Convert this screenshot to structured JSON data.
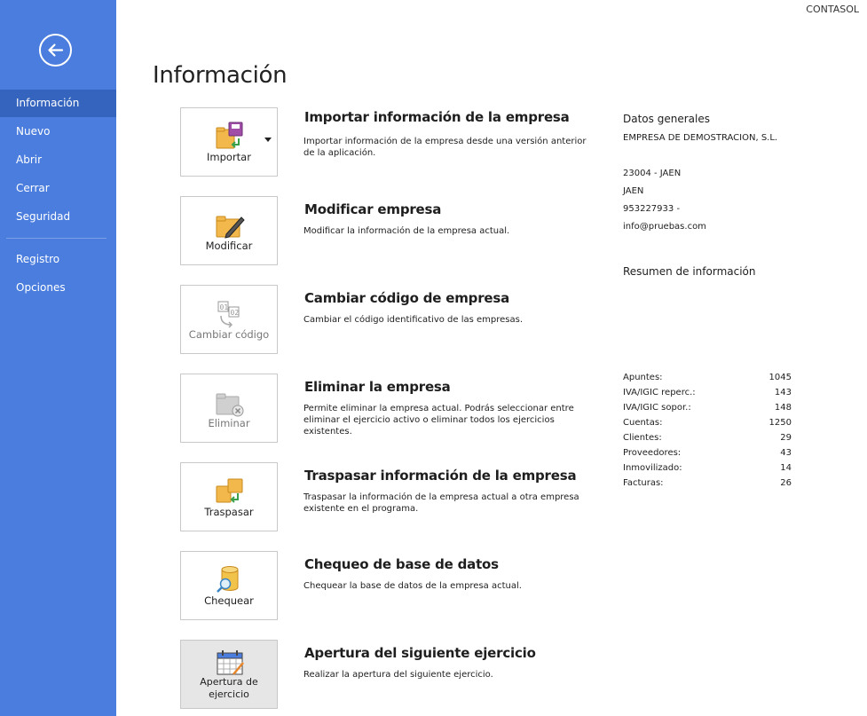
{
  "app": {
    "brand": "CONTASOL"
  },
  "nav": {
    "items": [
      {
        "label": "Información",
        "active": true
      },
      {
        "label": "Nuevo",
        "active": false
      },
      {
        "label": "Abrir",
        "active": false
      },
      {
        "label": "Cerrar",
        "active": false
      },
      {
        "label": "Seguridad",
        "active": false
      },
      {
        "label": "Registro",
        "active": false
      },
      {
        "label": "Opciones",
        "active": false
      }
    ]
  },
  "page": {
    "title": "Información"
  },
  "actions": [
    {
      "tile_label": "Importar",
      "title": "Importar información de la empresa",
      "description": "Importar información de la empresa desde una versión anterior de la aplicación.",
      "icon": "import-folder-icon",
      "has_dropdown": true,
      "enabled": true
    },
    {
      "tile_label": "Modificar",
      "title": "Modificar empresa",
      "description": "Modificar la información de la empresa actual.",
      "icon": "edit-folder-icon",
      "enabled": true
    },
    {
      "tile_label": "Cambiar código",
      "title": "Cambiar código de empresa",
      "description": "Cambiar el código identificativo de las empresas.",
      "icon": "change-code-icon",
      "enabled": false
    },
    {
      "tile_label": "Eliminar",
      "title": "Eliminar la empresa",
      "description": "Permite eliminar la empresa actual. Podrás seleccionar entre eliminar el ejercicio activo o eliminar todos los ejercicios existentes.",
      "icon": "delete-folder-icon",
      "enabled": false
    },
    {
      "tile_label": "Traspasar",
      "title": "Traspasar información de la empresa",
      "description": "Traspasar la información de la empresa actual a otra empresa existente en el programa.",
      "icon": "transfer-folder-icon",
      "enabled": true
    },
    {
      "tile_label": "Chequear",
      "title": "Chequeo de base de datos",
      "description": "Chequear la base de datos de la empresa actual.",
      "icon": "database-check-icon",
      "enabled": true
    },
    {
      "tile_label": "Apertura de ejercicio",
      "title": "Apertura del siguiente ejercicio",
      "description": "Realizar la apertura del siguiente ejercicio.",
      "icon": "calendar-open-icon",
      "enabled": true
    }
  ],
  "general": {
    "heading": "Datos generales",
    "company": "EMPRESA DE DEMOSTRACION, S.L.",
    "postal": "23004 - JAEN",
    "city": "JAEN",
    "phone": "953227933 -",
    "email": "info@pruebas.com"
  },
  "summary": {
    "heading": "Resumen de información",
    "rows": [
      {
        "label": "Apuntes:",
        "value": "1045"
      },
      {
        "label": "IVA/IGIC reperc.:",
        "value": "143"
      },
      {
        "label": "IVA/IGIC sopor.:",
        "value": "148"
      },
      {
        "label": "Cuentas:",
        "value": "1250"
      },
      {
        "label": "Clientes:",
        "value": "29"
      },
      {
        "label": "Proveedores:",
        "value": "43"
      },
      {
        "label": "Inmovilizado:",
        "value": "14"
      },
      {
        "label": "Facturas:",
        "value": "26"
      }
    ]
  },
  "colors": {
    "sidebar": "#4a7ddd",
    "sidebar_active": "#3564be",
    "folder": "#f2b84b",
    "accent_green": "#3aa04a"
  }
}
